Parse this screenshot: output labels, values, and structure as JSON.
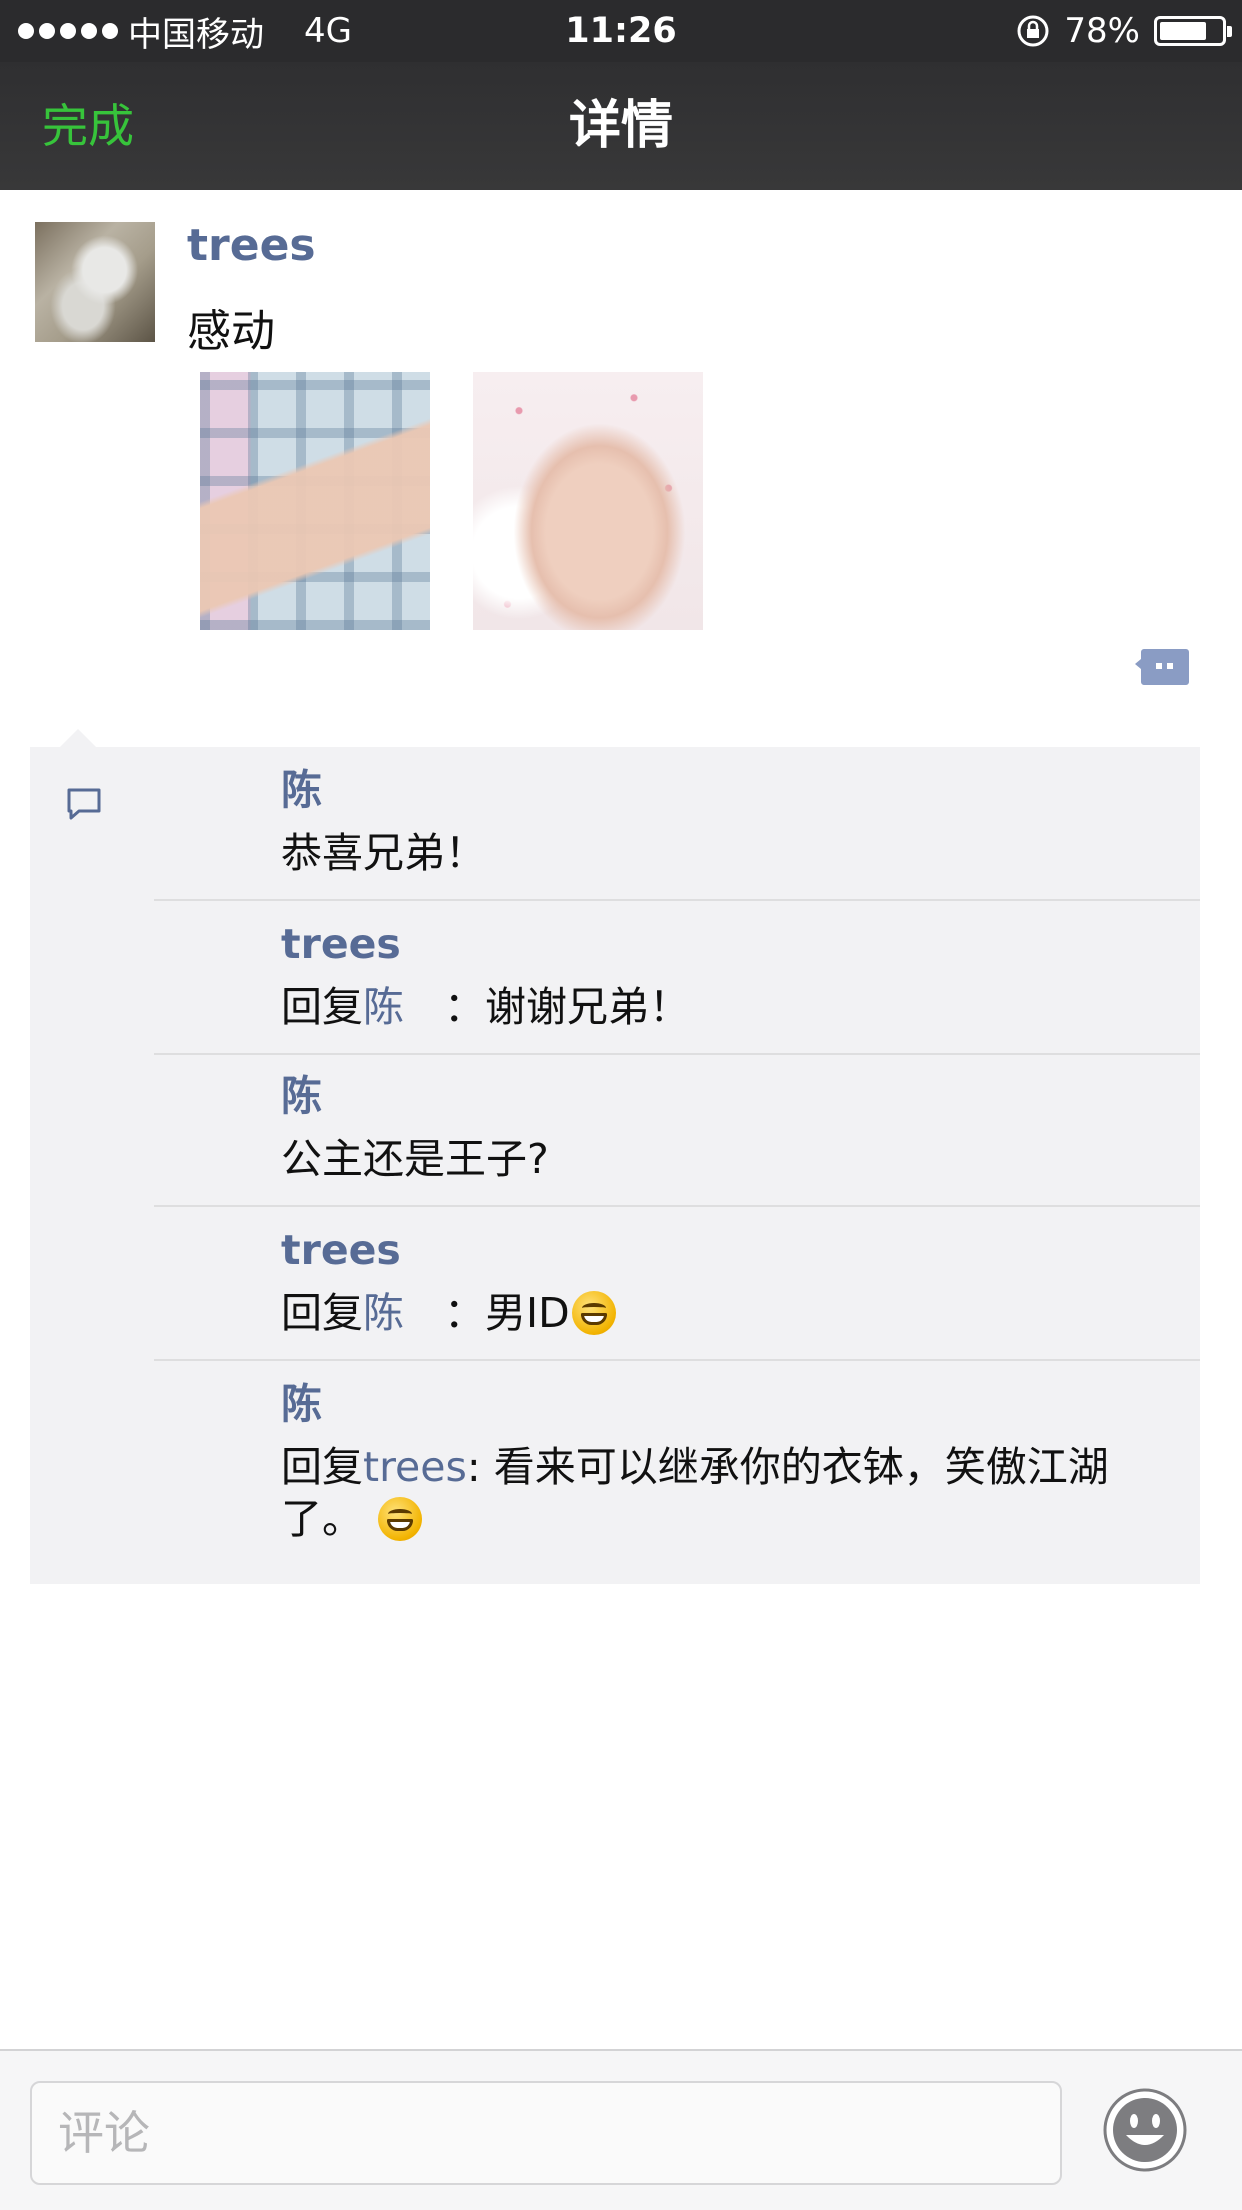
{
  "status_bar": {
    "carrier": "中国移动",
    "network": "4G",
    "time": "11:26",
    "battery": "78%",
    "signal_icon": "signal-dots-icon",
    "lock_icon": "rotation-lock-icon",
    "battery_icon": "battery-icon"
  },
  "nav": {
    "done_label": "完成",
    "title": "详情",
    "done_color": "#37c43b"
  },
  "post": {
    "author": "trees",
    "text": "感动",
    "photo_count": 2
  },
  "comments": [
    {
      "author": "陈",
      "body": "恭喜兄弟！"
    },
    {
      "author": "trees",
      "reply_prefix": "回复",
      "reply_to": "陈",
      "body": "：谢谢兄弟！"
    },
    {
      "author": "陈",
      "body": "公主还是王子?"
    },
    {
      "author": "trees",
      "reply_prefix": "回复",
      "reply_to": "陈",
      "body": "：男ID"
    },
    {
      "author": "陈",
      "reply_prefix": "回复",
      "reply_to": "trees",
      "body": ": 看来可以继承你的衣钵，笑傲江湖了。"
    }
  ],
  "input": {
    "placeholder": "评论"
  },
  "colors": {
    "link": "#576b95",
    "bar_bg": "#2b2b2d",
    "comments_bg": "#f2f2f4"
  }
}
